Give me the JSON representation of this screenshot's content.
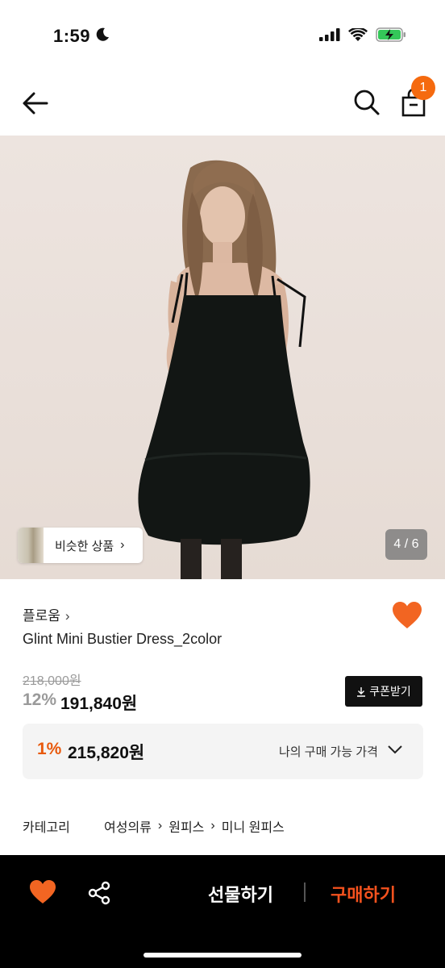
{
  "status": {
    "time": "1:59"
  },
  "header": {
    "cart_count": "1"
  },
  "gallery": {
    "similar_label": "비슷한 상품",
    "page_indicator": "4 / 6"
  },
  "product": {
    "brand": "플로움",
    "name": "Glint Mini Bustier Dress_2color",
    "original_price": "218,000원",
    "discount_rate": "12%",
    "sale_price": "191,840원",
    "coupon_label": "쿠폰받기"
  },
  "my_price": {
    "rate": "1%",
    "price": "215,820원",
    "label": "나의 구매 가능 가격"
  },
  "category": {
    "title": "카테고리",
    "path": [
      "여성의류",
      "원피스",
      "미니 원피스"
    ]
  },
  "bottom_bar": {
    "gift_label": "선물하기",
    "buy_label": "구매하기"
  },
  "colors": {
    "accent": "#f56a0f",
    "buy": "#f5521e",
    "heart": "#f26522"
  }
}
